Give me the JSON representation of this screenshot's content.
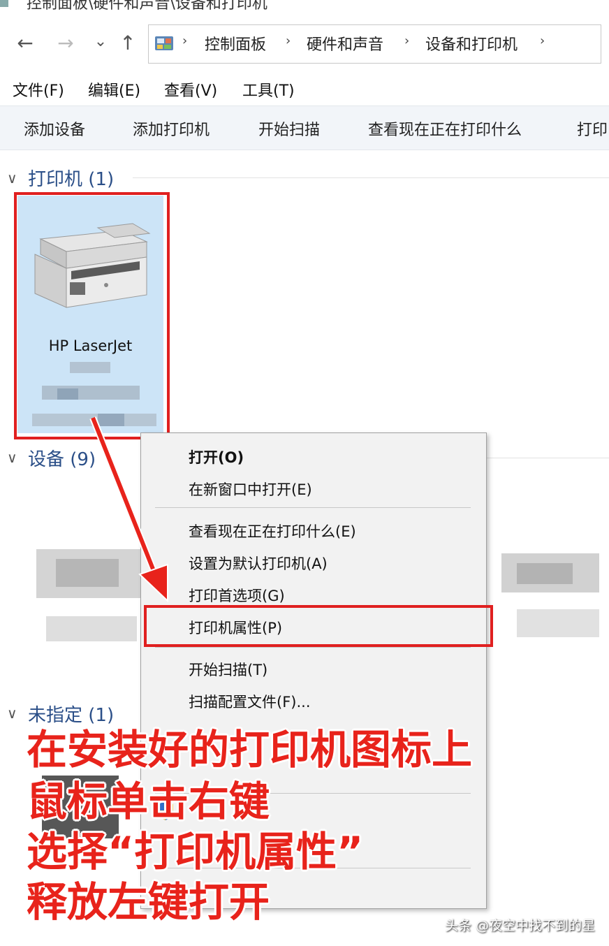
{
  "window": {
    "title": "控制面板\\硬件和声音\\设备和打印机"
  },
  "nav": {
    "back": "←",
    "forward": "→",
    "recent": "⌄",
    "up": "↑",
    "breadcrumbs": [
      "控制面板",
      "硬件和声音",
      "设备和打印机"
    ],
    "sep": "›"
  },
  "menubar": [
    "文件(F)",
    "编辑(E)",
    "查看(V)",
    "工具(T)"
  ],
  "commands": [
    "添加设备",
    "添加打印机",
    "开始扫描",
    "查看现在正在打印什么",
    "打印"
  ],
  "groups": {
    "printers": "打印机 (1)",
    "devices": "设备 (9)",
    "unspecified": "未指定 (1)"
  },
  "printer": {
    "name": "HP LaserJet"
  },
  "context_menu": {
    "items": [
      "打开(O)",
      "在新窗口中打开(E)",
      "查看现在正在打印什么(E)",
      "设置为默认打印机(A)",
      "打印首选项(G)",
      "打印机属性(P)",
      "开始扫描(T)",
      "扫描配置文件(F)..."
    ],
    "highlighted": "打印机属性(P)"
  },
  "annotation": {
    "lines": [
      "在安装好的打印机图标上",
      "鼠标单击右键",
      "选择“打印机属性”",
      "释放左键打开"
    ]
  },
  "watermark": "头条 @夜空中找不到的星",
  "colors": {
    "highlight_box": "#e02020",
    "annotation": "#e8231b",
    "tile_selected": "#cce4f7",
    "group_heading": "#2b4f88"
  }
}
